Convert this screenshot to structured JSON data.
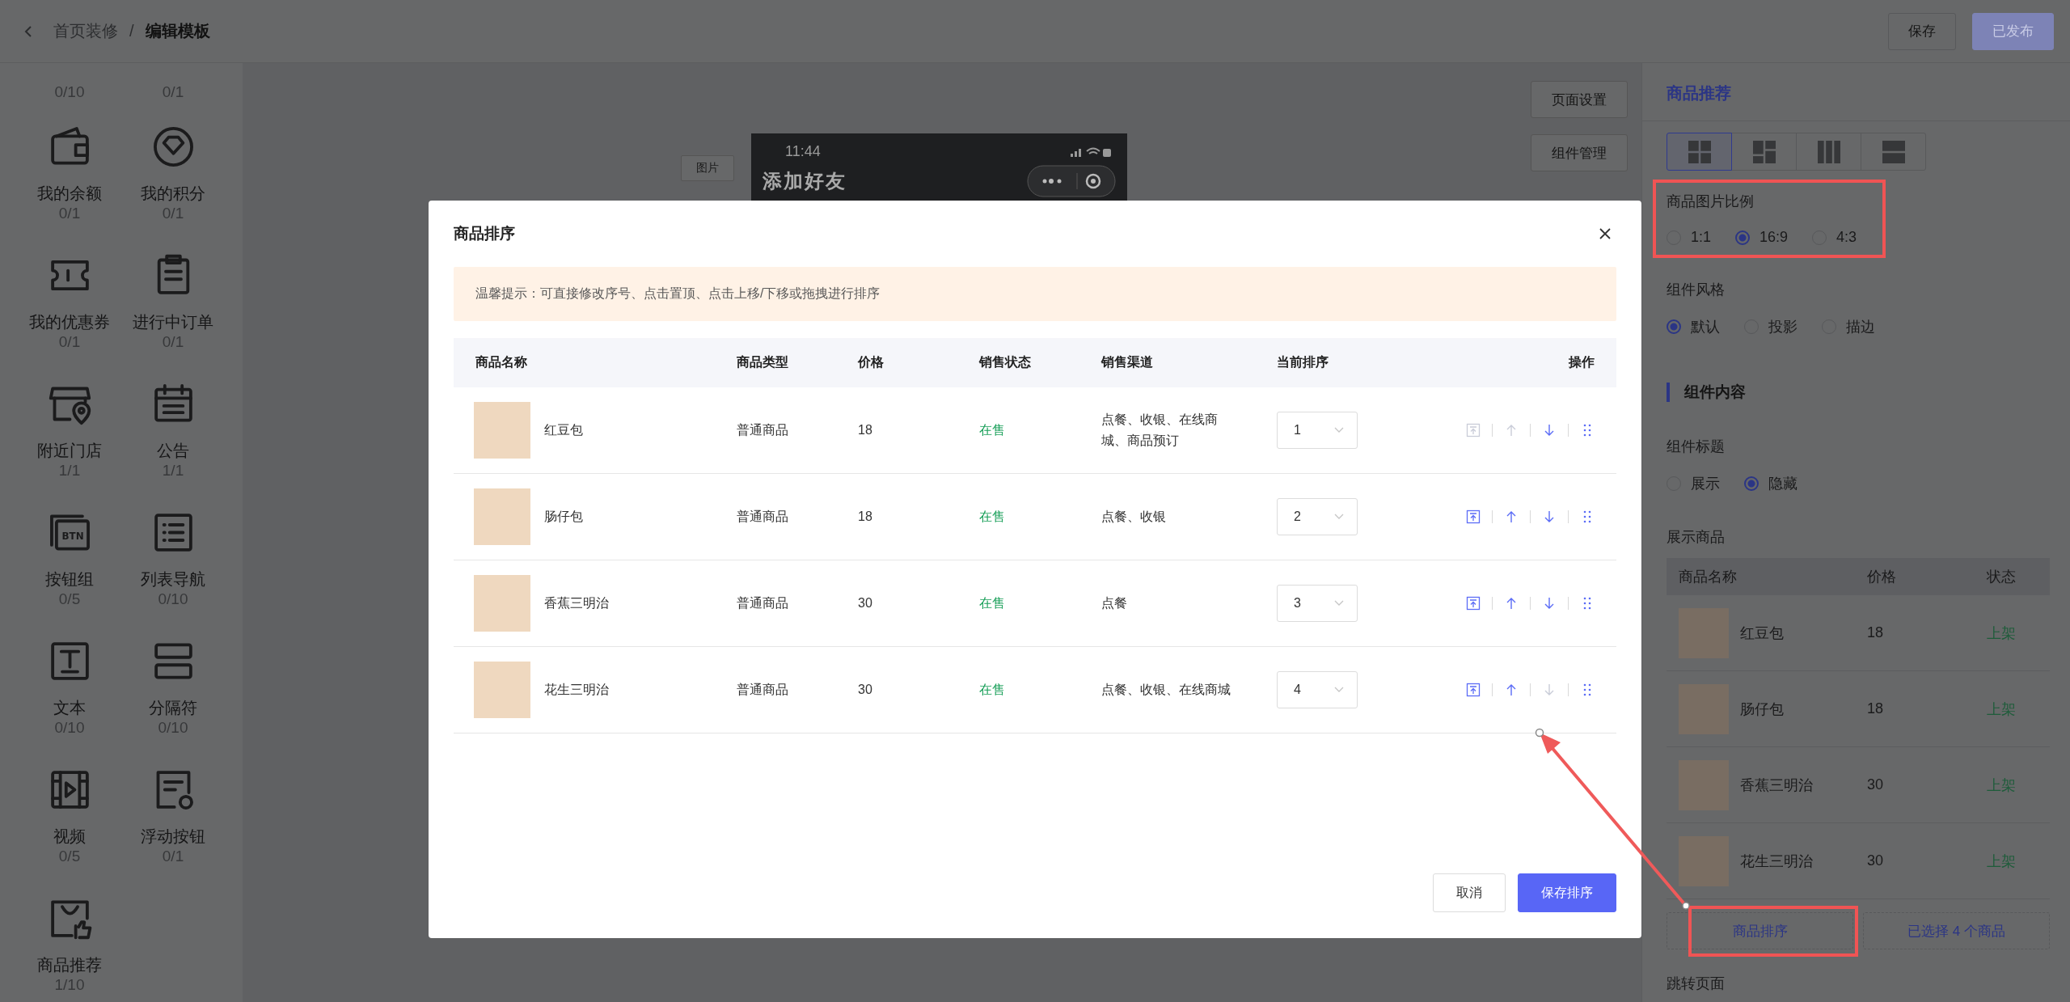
{
  "header": {
    "breadcrumb": [
      {
        "label": "首页装修",
        "current": false
      },
      {
        "label": "编辑模板",
        "current": true
      }
    ],
    "separator": "/",
    "buttons": [
      {
        "label": "保存",
        "kind": "default"
      },
      {
        "label": "已发布",
        "kind": "primary"
      }
    ]
  },
  "sidebar": {
    "items": [
      {
        "count": "0/10"
      },
      {
        "count": "0/1"
      },
      {
        "label": "我的余额",
        "count": "0/1"
      },
      {
        "label": "我的积分",
        "count": "0/1"
      },
      {
        "label": "我的优惠券",
        "count": "0/1"
      },
      {
        "label": "进行中订单",
        "count": "0/1"
      },
      {
        "label": "附近门店",
        "count": "1/1"
      },
      {
        "label": "公告",
        "count": "1/1"
      },
      {
        "label": "按钮组",
        "count": "0/5",
        "icon_text": "BTN"
      },
      {
        "label": "列表导航",
        "count": "0/10"
      },
      {
        "label": "文本",
        "count": "0/10"
      },
      {
        "label": "分隔符",
        "count": "0/10"
      },
      {
        "label": "视频",
        "count": "0/5"
      },
      {
        "label": "浮动按钮",
        "count": "0/1"
      },
      {
        "label": "商品推荐",
        "count": "1/10"
      }
    ]
  },
  "canvas": {
    "image_tag": "图片",
    "phone": {
      "time": "11:44",
      "title": "添加好友"
    },
    "side_buttons": [
      "页面设置",
      "组件管理"
    ]
  },
  "settings_panel": {
    "title": "商品推荐",
    "layouts": [
      {
        "selected": true
      },
      {
        "selected": false
      },
      {
        "selected": false
      },
      {
        "selected": false
      }
    ],
    "image_ratio": {
      "label": "商品图片比例",
      "options": [
        {
          "label": "1:1",
          "selected": false
        },
        {
          "label": "16:9",
          "selected": true
        },
        {
          "label": "4:3",
          "selected": false
        }
      ]
    },
    "style": {
      "label": "组件风格",
      "options": [
        {
          "label": "默认",
          "selected": true
        },
        {
          "label": "投影",
          "selected": false
        },
        {
          "label": "描边",
          "selected": false
        }
      ]
    },
    "section_title": "组件内容",
    "component_title": {
      "label": "组件标题",
      "options": [
        {
          "label": "展示",
          "selected": false
        },
        {
          "label": "隐藏",
          "selected": true
        }
      ]
    },
    "products": {
      "label": "展示商品",
      "columns": [
        "商品名称",
        "价格",
        "状态"
      ],
      "rows": [
        {
          "name": "红豆包",
          "price": "18",
          "status": "上架"
        },
        {
          "name": "肠仔包",
          "price": "18",
          "status": "上架"
        },
        {
          "name": "香蕉三明治",
          "price": "30",
          "status": "上架"
        },
        {
          "name": "花生三明治",
          "price": "30",
          "status": "上架"
        }
      ]
    },
    "sort_button": "商品排序",
    "selected_button": "已选择 4 个商品",
    "jump_label": "跳转页面"
  },
  "modal": {
    "title": "商品排序",
    "tip": "温馨提示：可直接修改序号、点击置顶、点击上移/下移或拖拽进行排序",
    "columns": [
      "商品名称",
      "商品类型",
      "价格",
      "销售状态",
      "销售渠道",
      "当前排序",
      "操作"
    ],
    "rows": [
      {
        "name": "红豆包",
        "type": "普通商品",
        "price": "18",
        "status": "在售",
        "channels": "点餐、收银、在线商城、商品预订",
        "order": "1",
        "actions": [
          {
            "kind": "top",
            "disabled": true
          },
          {
            "kind": "up",
            "disabled": true
          },
          {
            "kind": "down",
            "disabled": false
          },
          {
            "kind": "drag",
            "disabled": false
          }
        ]
      },
      {
        "name": "肠仔包",
        "type": "普通商品",
        "price": "18",
        "status": "在售",
        "channels": "点餐、收银",
        "order": "2",
        "actions": [
          {
            "kind": "top",
            "disabled": false
          },
          {
            "kind": "up",
            "disabled": false
          },
          {
            "kind": "down",
            "disabled": false
          },
          {
            "kind": "drag",
            "disabled": false
          }
        ]
      },
      {
        "name": "香蕉三明治",
        "type": "普通商品",
        "price": "30",
        "status": "在售",
        "channels": "点餐",
        "order": "3",
        "actions": [
          {
            "kind": "top",
            "disabled": false
          },
          {
            "kind": "up",
            "disabled": false
          },
          {
            "kind": "down",
            "disabled": false
          },
          {
            "kind": "drag",
            "disabled": false
          }
        ]
      },
      {
        "name": "花生三明治",
        "type": "普通商品",
        "price": "30",
        "status": "在售",
        "channels": "点餐、收银、在线商城",
        "order": "4",
        "actions": [
          {
            "kind": "top",
            "disabled": false
          },
          {
            "kind": "up",
            "disabled": false
          },
          {
            "kind": "down",
            "disabled": true
          },
          {
            "kind": "drag",
            "disabled": false
          }
        ]
      }
    ],
    "buttons": [
      {
        "label": "取消",
        "kind": "default"
      },
      {
        "label": "保存排序",
        "kind": "primary"
      }
    ]
  }
}
